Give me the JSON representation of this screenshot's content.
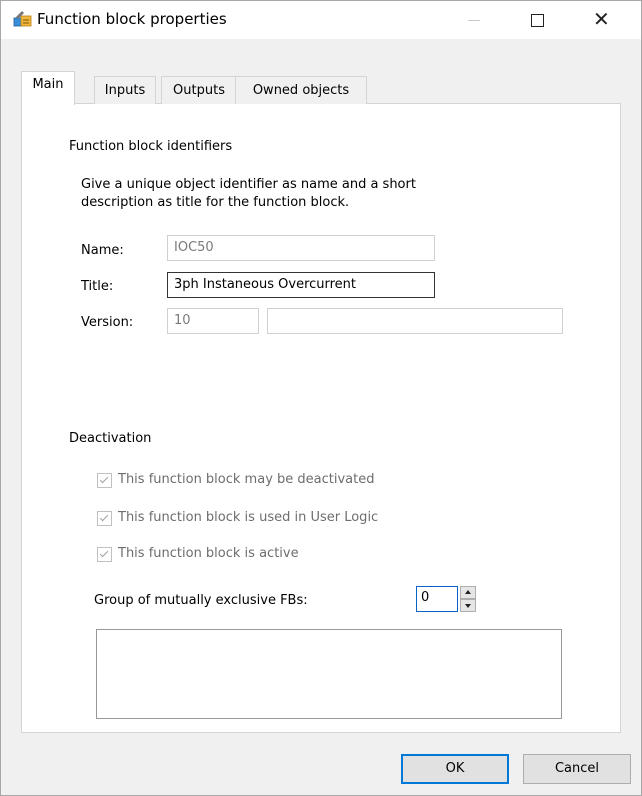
{
  "window": {
    "title": "Function block properties",
    "minimize_label": "",
    "close_glyph": "✕"
  },
  "tabs": [
    "Main",
    "Inputs",
    "Outputs",
    "Owned objects"
  ],
  "identifiers": {
    "heading": "Function block identifiers",
    "description_line1": "Give a unique object identifier as name and a short",
    "description_line2": "description as title for the function block.",
    "name_label": "Name:",
    "name_value": "IOC50",
    "title_label": "Title:",
    "title_value": "3ph Instaneous Overcurrent",
    "version_label": "Version:",
    "version_value": "10",
    "version_extra": ""
  },
  "deactivation": {
    "heading": "Deactivation",
    "checkboxes": [
      {
        "label": "This function block may be deactivated",
        "checked": true
      },
      {
        "label": "This function block is used in User Logic",
        "checked": true
      },
      {
        "label": "This function block is active",
        "checked": true
      }
    ],
    "group_label": "Group of mutually exclusive FBs:",
    "group_value": "0"
  },
  "buttons": {
    "ok": "OK",
    "cancel": "Cancel"
  },
  "colors": {
    "accent": "#0078d7",
    "panel": "#ffffff",
    "window": "#f0f0f0"
  }
}
